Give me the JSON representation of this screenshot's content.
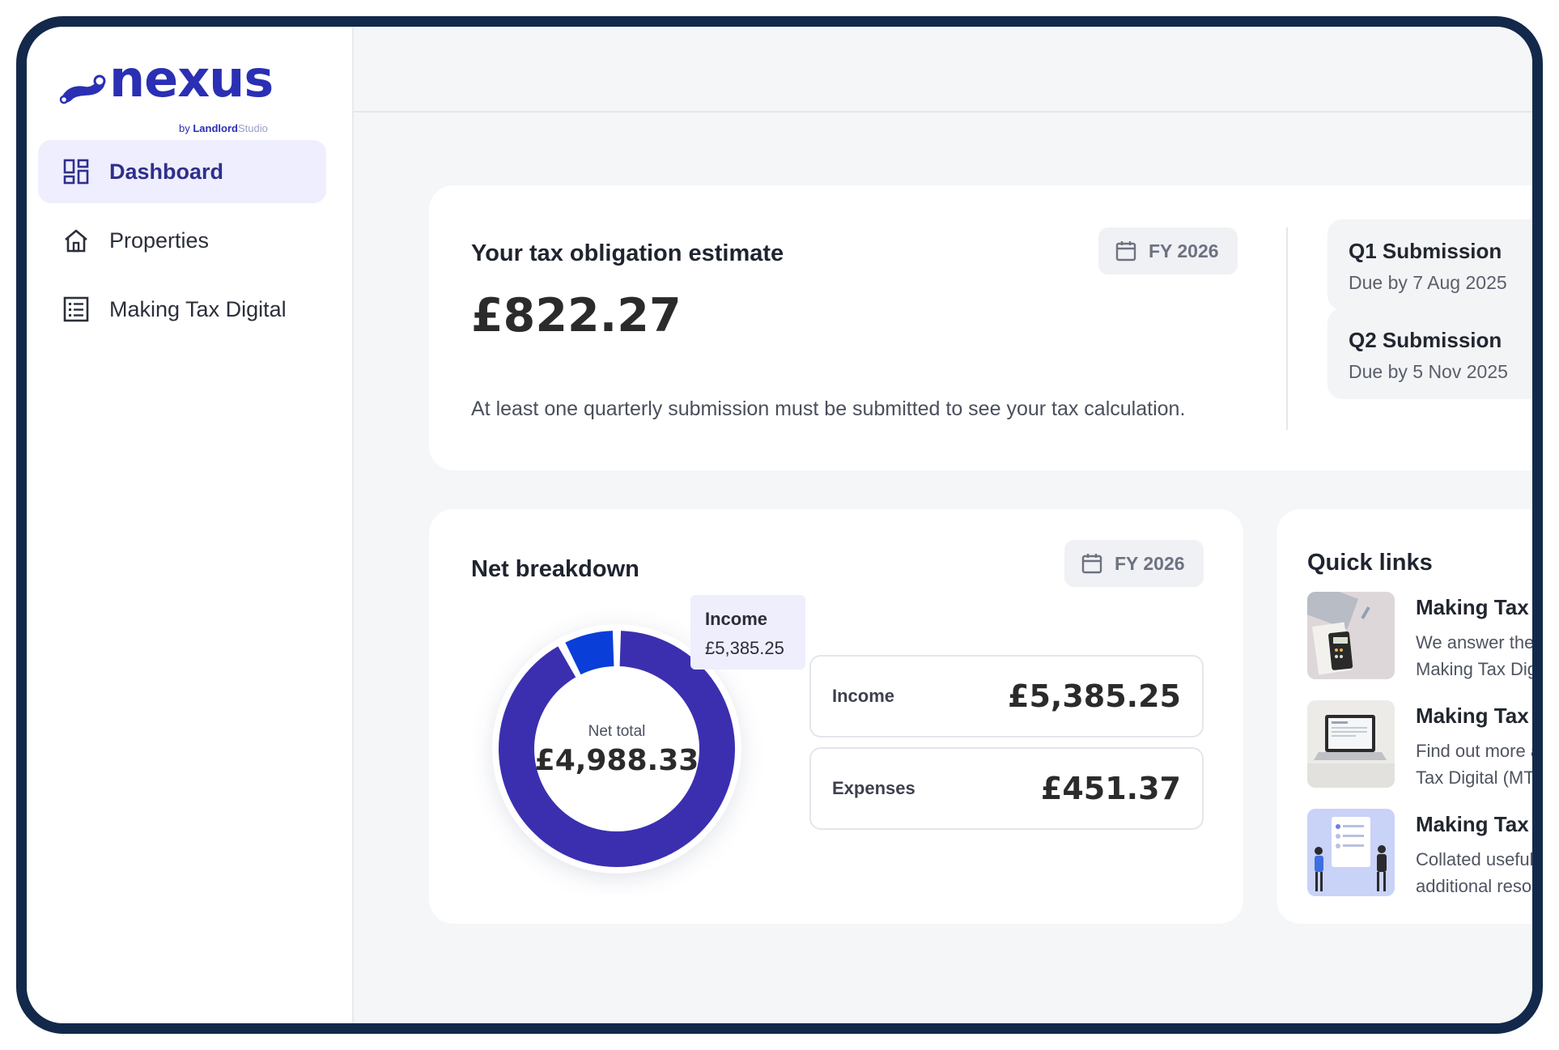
{
  "brand": {
    "name": "nexus",
    "byline_prefix": "by ",
    "byline_bold": "Landlord",
    "byline_light": "Studio",
    "color": "#2a2fb4"
  },
  "sidebar": {
    "items": [
      {
        "label": "Dashboard",
        "icon": "dashboard-icon",
        "active": true
      },
      {
        "label": "Properties",
        "icon": "home-icon",
        "active": false
      },
      {
        "label": "Making Tax Digital",
        "icon": "list-icon",
        "active": false
      }
    ]
  },
  "tax_card": {
    "title": "Your tax obligation estimate",
    "amount": "£822.27",
    "note": "At least one quarterly submission must be submitted to see your tax calculation.",
    "period": "FY 2026",
    "submissions": [
      {
        "title": "Q1 Submission",
        "due": "Due by 7 Aug 2025"
      },
      {
        "title": "Q2 Submission",
        "due": "Due by 5 Nov 2025"
      }
    ]
  },
  "net_card": {
    "title": "Net breakdown",
    "period": "FY 2026",
    "center_label": "Net total",
    "center_value": "£4,988.33",
    "tooltip": {
      "label": "Income",
      "value": "£5,385.25"
    },
    "rows": [
      {
        "label": "Income",
        "value": "£5,385.25"
      },
      {
        "label": "Expenses",
        "value": "£451.37"
      }
    ]
  },
  "chart_data": {
    "type": "pie",
    "categories": [
      "Income",
      "Expenses"
    ],
    "values": [
      5385.25,
      451.37
    ],
    "colors": [
      "#3b2fb0",
      "#0a3ed8"
    ],
    "title": ""
  },
  "quick_links": {
    "title": "Quick links",
    "items": [
      {
        "title": "Making Tax Di",
        "desc1": "We answer the m",
        "desc2": "Making Tax Digit"
      },
      {
        "title": "Making Tax Di",
        "desc1": "Find out more ar",
        "desc2": "Tax Digital (MTD"
      },
      {
        "title": "Making Tax Di",
        "desc1": "Collated useful a",
        "desc2": "additional resour"
      }
    ]
  },
  "colors": {
    "accent": "#2e2f8c",
    "frame": "#13294b",
    "active_nav_bg": "#efeefe"
  }
}
